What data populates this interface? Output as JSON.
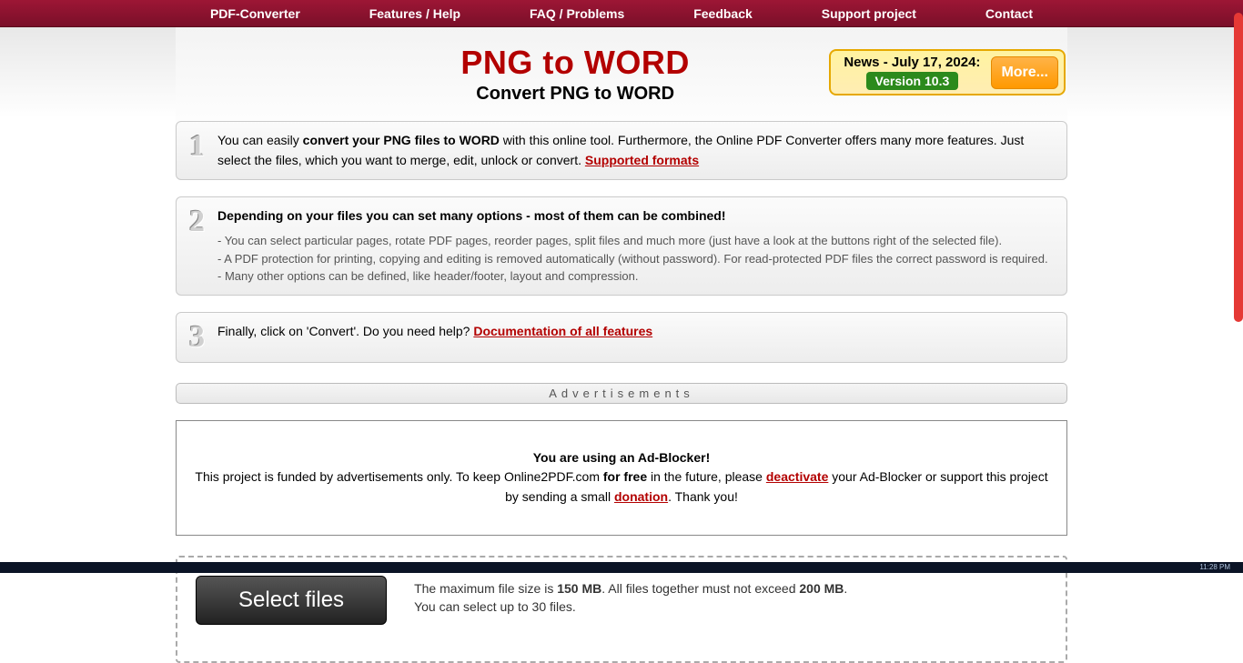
{
  "nav": {
    "items": [
      "PDF-Converter",
      "Features / Help",
      "FAQ / Problems",
      "Feedback",
      "Support project",
      "Contact"
    ]
  },
  "title": {
    "main": "PNG to WORD",
    "sub": "Convert PNG to WORD"
  },
  "news": {
    "line1": "News - July 17, 2024:",
    "version": "Version 10.3",
    "more": "More..."
  },
  "steps": [
    {
      "num": "1",
      "pre": "You can easily ",
      "bold": "convert your PNG files to WORD",
      "post": " with this online tool. Furthermore, the Online PDF Converter offers many more features. Just select the files, which you want to merge, edit, unlock or convert. ",
      "link": "Supported formats"
    },
    {
      "num": "2",
      "pre": "",
      "bold": "Depending on your files you can set many options - most of them can be combined!",
      "sub": [
        "- You can select particular pages, rotate PDF pages, reorder pages, split files and much more (just have a look at the buttons right of the selected file).",
        "- A PDF protection for printing, copying and editing is removed automatically (without password). For read-protected PDF files the correct password is required.",
        "- Many other options can be defined, like header/footer, layout and compression."
      ]
    },
    {
      "num": "3",
      "pre": "Finally, click on 'Convert'. Do you need help? ",
      "link": "Documentation of all features"
    }
  ],
  "ad": {
    "label": "Advertisements",
    "title": "You are using an Ad-Blocker!",
    "p1a": "This project is funded by advertisements only. To keep Online2PDF.com ",
    "p1b": "for free",
    "p1c": " in the future, please ",
    "link1": "deactivate",
    "p1d": " your Ad-Blocker or support this project by sending a small ",
    "link2": "donation",
    "p1e": ". Thank you!"
  },
  "upload": {
    "selectBtn": "Select files",
    "info1a": "The maximum file size is ",
    "info1b": "150 MB",
    "info1c": ". All files together must not exceed ",
    "info1d": "200 MB",
    "info1e": ".",
    "info2": "You can select up to 30 files."
  },
  "taskbar": {
    "time": "11:28 PM"
  }
}
